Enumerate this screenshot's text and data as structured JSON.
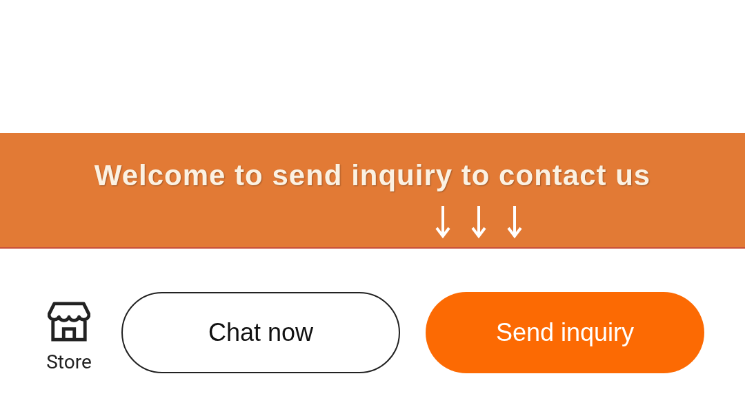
{
  "banner": {
    "text": "Welcome to send inquiry to contact us"
  },
  "bottom_bar": {
    "store": {
      "label": "Store"
    },
    "buttons": [
      {
        "label": "Chat now",
        "kind": "outline"
      },
      {
        "label": "Send inquiry",
        "kind": "primary"
      }
    ]
  }
}
